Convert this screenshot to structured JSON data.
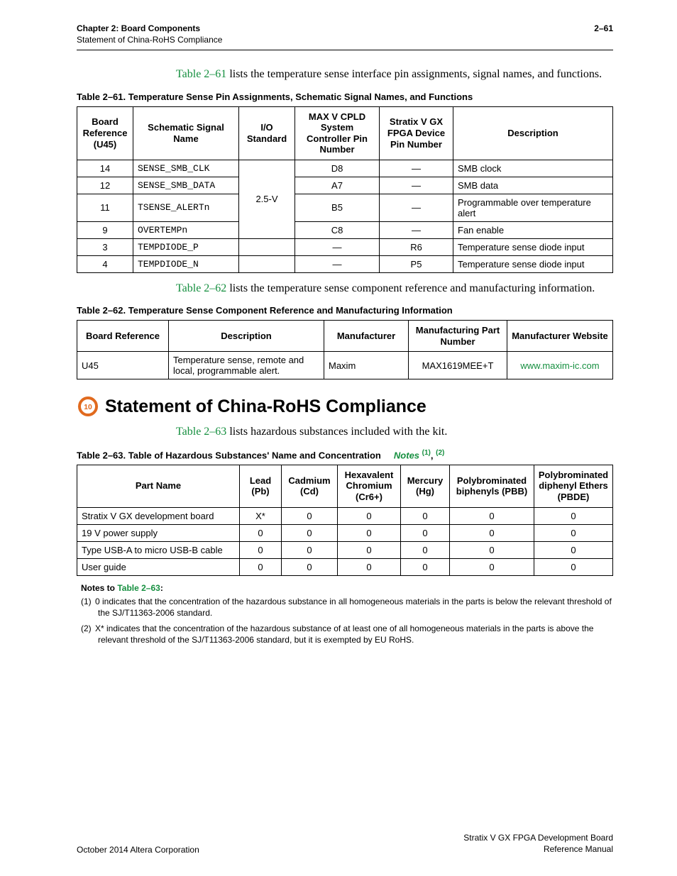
{
  "header": {
    "chapter": "Chapter 2: Board Components",
    "section": "Statement of China-RoHS Compliance",
    "page": "2–61"
  },
  "intro61_link": "Table 2–61",
  "intro61_text": " lists the temperature sense interface pin assignments, signal names, and functions.",
  "table61": {
    "caption": "Table 2–61.  Temperature Sense Pin Assignments, Schematic Signal Names, and Functions",
    "h0": "Board Reference (U45)",
    "h1": "Schematic Signal Name",
    "h2": "I/O Standard",
    "h3": "MAX V CPLD System Controller Pin Number",
    "h4": "Stratix V GX FPGA Device Pin Number",
    "h5": "Description",
    "io_std": "2.5-V",
    "rows": [
      {
        "ref": "14",
        "sig": "SENSE_SMB_CLK",
        "max": "D8",
        "sv": "—",
        "desc": "SMB clock"
      },
      {
        "ref": "12",
        "sig": "SENSE_SMB_DATA",
        "max": "A7",
        "sv": "—",
        "desc": "SMB data"
      },
      {
        "ref": "11",
        "sig": "TSENSE_ALERTn",
        "max": "B5",
        "sv": "—",
        "desc": "Programmable over temperature alert"
      },
      {
        "ref": "9",
        "sig": "OVERTEMPn",
        "max": "C8",
        "sv": "—",
        "desc": "Fan enable"
      },
      {
        "ref": "3",
        "sig": "TEMPDIODE_P",
        "max": "—",
        "sv": "R6",
        "desc": "Temperature sense diode input"
      },
      {
        "ref": "4",
        "sig": "TEMPDIODE_N",
        "max": "—",
        "sv": "P5",
        "desc": "Temperature sense diode input"
      }
    ]
  },
  "intro62_link": "Table 2–62",
  "intro62_text": " lists the temperature sense component reference and manufacturing information.",
  "table62": {
    "caption": "Table 2–62.  Temperature Sense Component Reference and Manufacturing Information",
    "h0": "Board Reference",
    "h1": "Description",
    "h2": "Manufacturer",
    "h3": "Manufacturing Part Number",
    "h4": "Manufacturer Website",
    "row": {
      "ref": "U45",
      "desc": "Temperature sense, remote and local, programmable alert.",
      "mfr": "Maxim",
      "pn": "MAX1619MEE+T",
      "site": "www.maxim-ic.com"
    }
  },
  "h2": "Statement of China-RoHS Compliance",
  "intro63_link": "Table 2–63",
  "intro63_text": " lists hazardous substances included with the kit.",
  "table63": {
    "caption_main": "Table 2–63.  Table of Hazardous Substances' Name and Concentration",
    "notes_label": "Notes",
    "sup1": "(1)",
    "comma": ", ",
    "sup2": "(2)",
    "h0": "Part Name",
    "h1": "Lead (Pb)",
    "h2": "Cadmium (Cd)",
    "h3": "Hexavalent Chromium (Cr6+)",
    "h4": "Mercury (Hg)",
    "h5": "Polybrominated biphenyls (PBB)",
    "h6": "Polybrominated diphenyl Ethers (PBDE)",
    "rows": [
      {
        "name": "Stratix V GX development board",
        "pb": "X*",
        "cd": "0",
        "cr": "0",
        "hg": "0",
        "pbb": "0",
        "pbde": "0"
      },
      {
        "name": "19 V power supply",
        "pb": "0",
        "cd": "0",
        "cr": "0",
        "hg": "0",
        "pbb": "0",
        "pbde": "0"
      },
      {
        "name": "Type USB-A to micro USB-B cable",
        "pb": "0",
        "cd": "0",
        "cr": "0",
        "hg": "0",
        "pbb": "0",
        "pbde": "0"
      },
      {
        "name": "User guide",
        "pb": "0",
        "cd": "0",
        "cr": "0",
        "hg": "0",
        "pbb": "0",
        "pbde": "0"
      }
    ]
  },
  "notes": {
    "heading_pre": "Notes to ",
    "heading_link": "Table 2–63",
    "heading_post": ":",
    "n1_num": "(1)",
    "n1": "0 indicates that the concentration of the hazardous substance in all homogeneous materials in the parts is below the relevant threshold of the SJ/T11363-2006 standard.",
    "n2_num": "(2)",
    "n2": "X* indicates that the concentration of the hazardous substance of at least one of all homogeneous materials in the parts is above the relevant threshold of the SJ/T11363-2006 standard, but it is exempted by EU RoHS."
  },
  "footer": {
    "left": "October 2014   Altera Corporation",
    "right1": "Stratix V GX FPGA Development Board",
    "right2": "Reference Manual"
  }
}
